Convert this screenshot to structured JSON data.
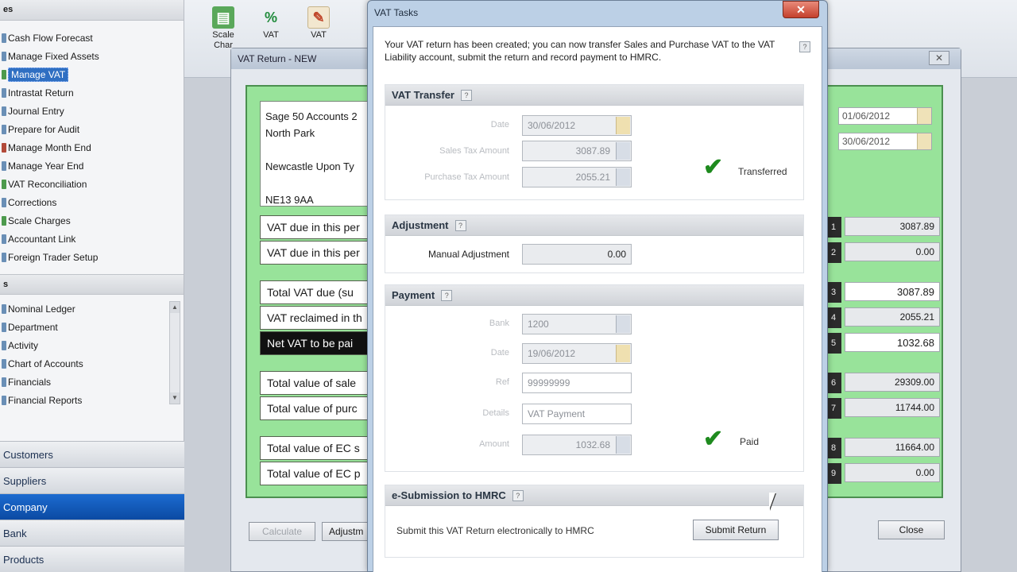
{
  "sidebar": {
    "header": "es",
    "tasks": [
      {
        "label": "Cash Flow Forecast",
        "icon": "chart-icon",
        "color": "b"
      },
      {
        "label": "Manage Fixed Assets",
        "icon": "assets-icon",
        "color": "b"
      },
      {
        "label": "Manage VAT",
        "icon": "vat-icon",
        "color": "g",
        "selected": true
      },
      {
        "label": "Intrastat Return",
        "icon": "return-icon",
        "color": "b"
      },
      {
        "label": "Journal Entry",
        "icon": "journal-icon",
        "color": "b"
      },
      {
        "label": "Prepare for Audit",
        "icon": "audit-icon",
        "color": "b"
      },
      {
        "label": "Manage Month End",
        "icon": "month-end-icon",
        "color": "r"
      },
      {
        "label": "Manage Year End",
        "icon": "year-end-icon",
        "color": "b"
      },
      {
        "label": "VAT Reconciliation",
        "icon": "reconcile-icon",
        "color": "g"
      },
      {
        "label": "Corrections",
        "icon": "corrections-icon",
        "color": "b"
      },
      {
        "label": "Scale Charges",
        "icon": "scale-icon",
        "color": "g"
      },
      {
        "label": "Accountant Link",
        "icon": "link-icon",
        "color": "b"
      },
      {
        "label": "Foreign Trader Setup",
        "icon": "globe-icon",
        "color": "b"
      }
    ],
    "links_header": "s",
    "links": [
      {
        "label": "Nominal Ledger",
        "icon": "ledger-icon"
      },
      {
        "label": "Department",
        "icon": "department-icon"
      },
      {
        "label": "Activity",
        "icon": "activity-icon"
      },
      {
        "label": "Chart of Accounts",
        "icon": "accounts-icon"
      },
      {
        "label": "Financials",
        "icon": "financials-icon"
      },
      {
        "label": "Financial Reports",
        "icon": "reports-icon"
      }
    ],
    "nav": [
      {
        "label": "Customers",
        "active": false
      },
      {
        "label": "Suppliers",
        "active": false
      },
      {
        "label": "Company",
        "active": true
      },
      {
        "label": "Bank",
        "active": false
      },
      {
        "label": "Products",
        "active": false
      }
    ]
  },
  "toolbar": {
    "buttons": [
      {
        "label": "Scale\nChar",
        "icon": "scale-charges-icon"
      },
      {
        "label": "VAT",
        "icon": "vat-percent-icon"
      },
      {
        "label": "VAT",
        "icon": "vat-doc-icon"
      }
    ]
  },
  "vat_return": {
    "title": "VAT Return - NEW",
    "address": [
      "Sage 50 Accounts 2",
      "North Park",
      "",
      "Newcastle Upon Ty",
      "",
      "NE13 9AA"
    ],
    "rows": [
      {
        "label": "VAT due in this per",
        "box": "1",
        "value": "3087.89"
      },
      {
        "label": "VAT due in this per",
        "box": "2",
        "value": "0.00"
      },
      {
        "label": "Total VAT due (su",
        "box": "3",
        "value": "3087.89"
      },
      {
        "label": "VAT reclaimed in th",
        "box": "4",
        "value": "2055.21"
      },
      {
        "label": "Net VAT to be pai",
        "box": "5",
        "value": "1032.68"
      },
      {
        "label": "Total value of sale",
        "box": "6",
        "value": "29309.00"
      },
      {
        "label": "Total value of purc",
        "box": "7",
        "value": "11744.00"
      },
      {
        "label": "Total value of EC s",
        "box": "8",
        "value": "11664.00"
      },
      {
        "label": "Total value of EC p",
        "box": "9",
        "value": "0.00"
      }
    ],
    "date_from": "01/06/2012",
    "date_to": "30/06/2012",
    "buttons": {
      "left1": "Calculate",
      "left2": "Adjustm",
      "close": "Close"
    }
  },
  "vat_tasks": {
    "title": "VAT Tasks",
    "intro": "Your VAT return has been created; you can now transfer Sales and Purchase VAT to the VAT Liability account, submit the return and record payment to HMRC.",
    "transfer": {
      "heading": "VAT Transfer",
      "date_label": "Date",
      "date": "30/06/2012",
      "sales_label": "Sales Tax Amount",
      "sales": "3087.89",
      "purchase_label": "Purchase Tax Amount",
      "purchase": "2055.21",
      "status": "Transferred"
    },
    "adjustment": {
      "heading": "Adjustment",
      "label": "Manual Adjustment",
      "value": "0.00"
    },
    "payment": {
      "heading": "Payment",
      "bank_label": "Bank",
      "bank": "1200",
      "date_label": "Date",
      "date": "19/06/2012",
      "ref_label": "Ref",
      "ref": "99999999",
      "details_label": "Details",
      "details": "VAT Payment",
      "amount_label": "Amount",
      "amount": "1032.68",
      "status": "Paid"
    },
    "esubmission": {
      "heading": "e-Submission to HMRC",
      "text": "Submit this VAT Return electronically to HMRC",
      "button": "Submit Return"
    }
  }
}
